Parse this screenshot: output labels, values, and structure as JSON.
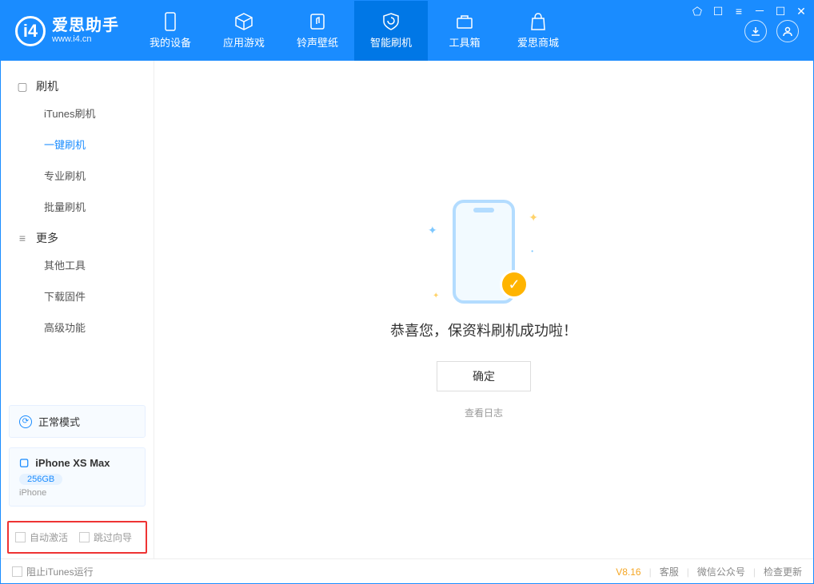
{
  "app": {
    "name": "爱思助手",
    "url": "www.i4.cn"
  },
  "tabs": {
    "device": "我的设备",
    "apps": "应用游戏",
    "ring": "铃声壁纸",
    "flash": "智能刷机",
    "tools": "工具箱",
    "store": "爱思商城"
  },
  "sidebar": {
    "group1": "刷机",
    "items1": {
      "itunes": "iTunes刷机",
      "oneclick": "一键刷机",
      "pro": "专业刷机",
      "batch": "批量刷机"
    },
    "group2": "更多",
    "items2": {
      "other": "其他工具",
      "firmware": "下载固件",
      "advanced": "高级功能"
    }
  },
  "device": {
    "mode": "正常模式",
    "name": "iPhone XS Max",
    "storage": "256GB",
    "type": "iPhone"
  },
  "options": {
    "auto_activate": "自动激活",
    "skip_guide": "跳过向导"
  },
  "main": {
    "success": "恭喜您，保资料刷机成功啦！",
    "ok": "确定",
    "log": "查看日志"
  },
  "footer": {
    "block_itunes": "阻止iTunes运行",
    "version": "V8.16",
    "support": "客服",
    "wechat": "微信公众号",
    "update": "检查更新"
  }
}
